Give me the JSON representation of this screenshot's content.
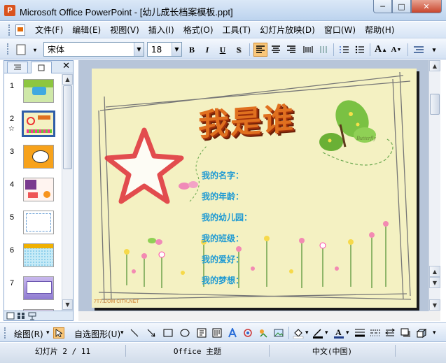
{
  "window": {
    "title": "Microsoft Office PowerPoint - [幼儿成长档案模板.ppt]",
    "minimize_glyph": "─",
    "maximize_glyph": "□",
    "close_glyph": "✕"
  },
  "menubar": {
    "items": [
      "文件(F)",
      "编辑(E)",
      "视图(V)",
      "插入(I)",
      "格式(O)",
      "工具(T)",
      "幻灯片放映(D)",
      "窗口(W)",
      "帮助(H)"
    ]
  },
  "format_toolbar": {
    "font_name": "宋体",
    "font_size": "18",
    "bold_glyph": "B",
    "italic_glyph": "I",
    "underline_glyph": "U",
    "shadow_glyph": "S",
    "grow_font_glyph": "A",
    "shrink_font_glyph": "A"
  },
  "left_pane": {
    "close_glyph": "✕",
    "selected_index": 1,
    "slides": [
      {
        "number": "1"
      },
      {
        "number": "2"
      },
      {
        "number": "3"
      },
      {
        "number": "4"
      },
      {
        "number": "5"
      },
      {
        "number": "6"
      },
      {
        "number": "7"
      }
    ]
  },
  "slide": {
    "title": "我是谁",
    "fields": [
      "我的名字：",
      "我的年龄：",
      "我的幼儿园：",
      "我的班级：",
      "我的爱好：",
      "我的梦想："
    ],
    "butterfly_text": "Butterfly",
    "watermark": "7T7.COM CITK.NET"
  },
  "drawing_toolbar": {
    "draw_label": "绘图(R)",
    "autoshapes_label": "自选图形(U)"
  },
  "statusbar": {
    "slide_position": "幻灯片 2 / 11",
    "theme": "Office 主题",
    "language": "中文(中国)"
  },
  "colors": {
    "slide_background": "#f4f1c2",
    "title_orange": "#e0701f",
    "field_blue": "#1f9ad3",
    "selection_blue": "#2e5da8"
  }
}
